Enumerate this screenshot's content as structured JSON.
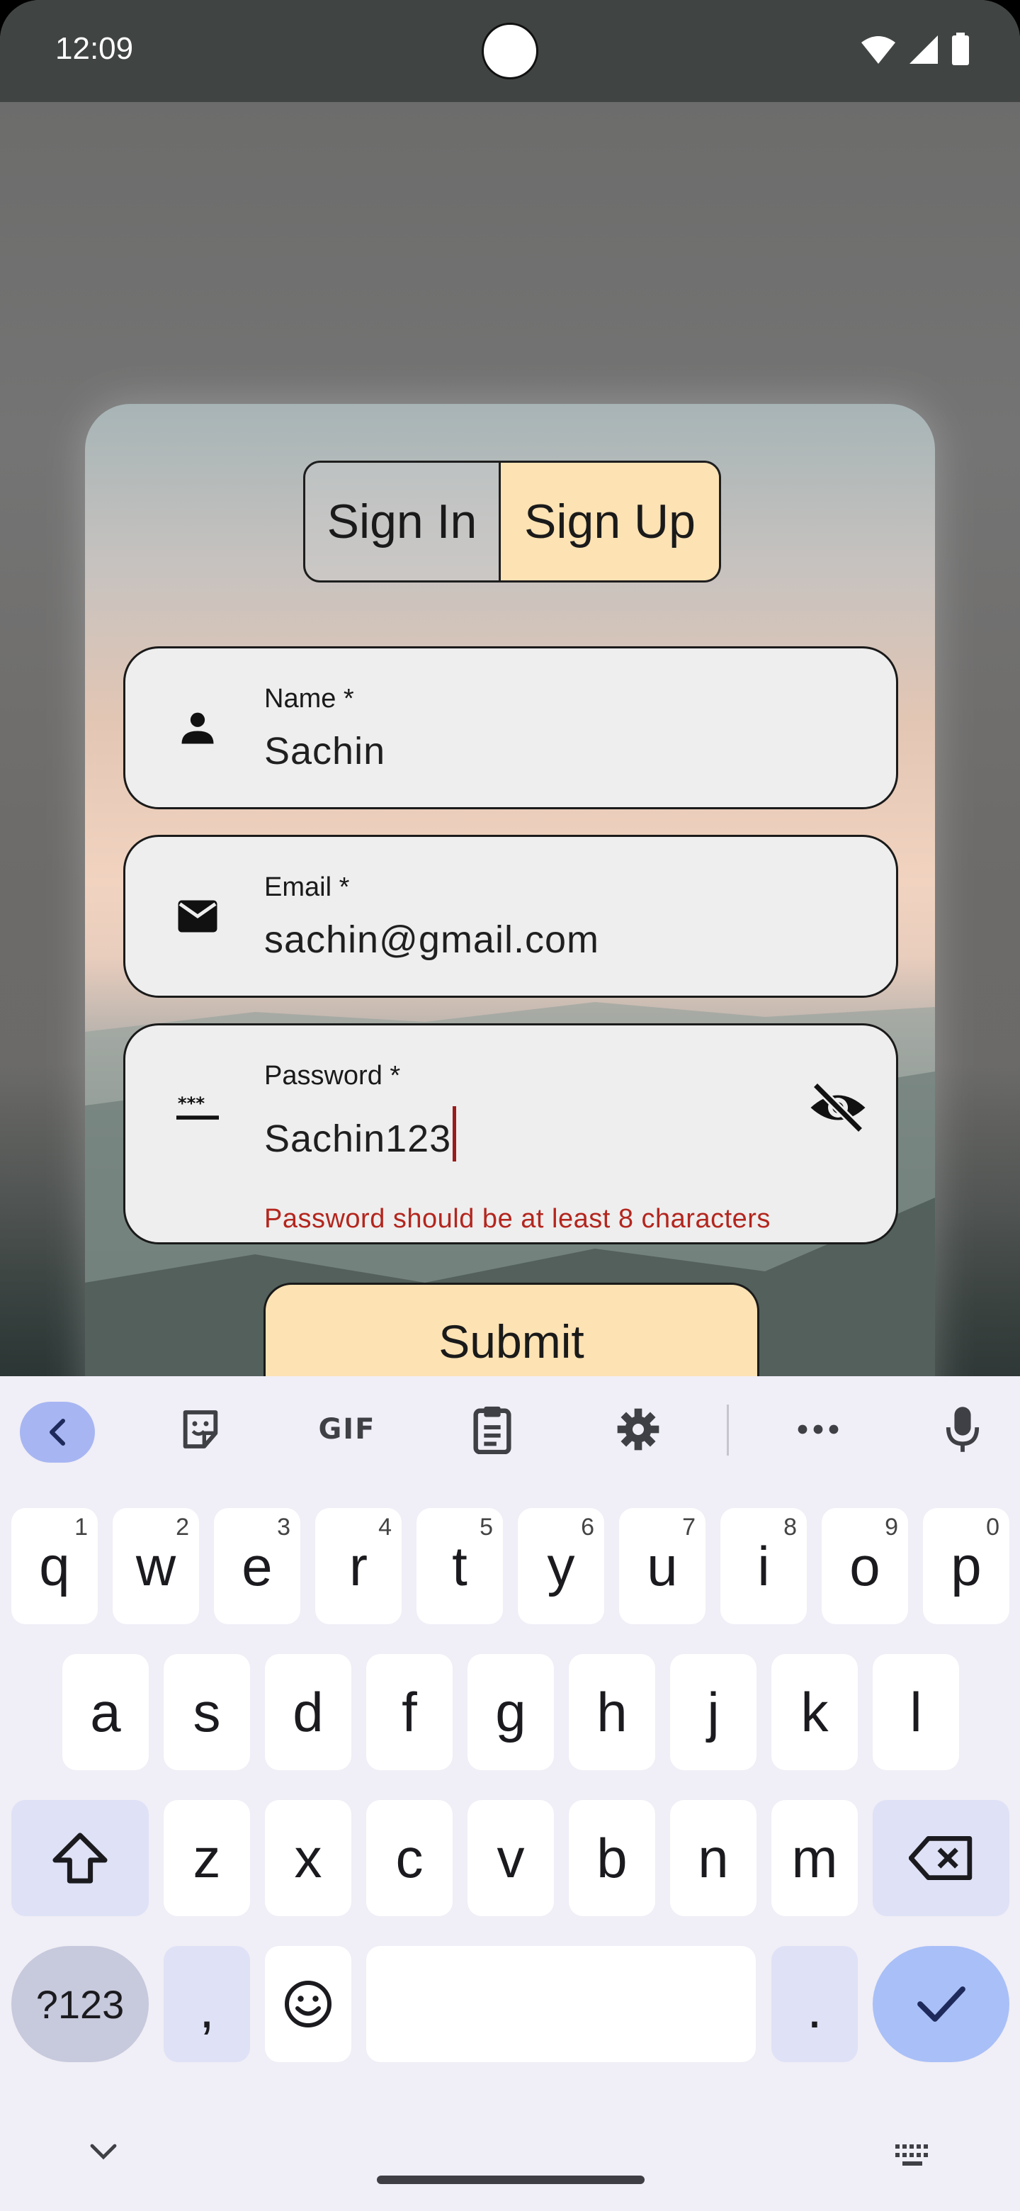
{
  "status_bar": {
    "time": "12:09"
  },
  "auth": {
    "tabs": {
      "sign_in": "Sign In",
      "sign_up": "Sign Up",
      "selected": "Sign Up"
    },
    "name": {
      "label": "Name *",
      "value": "Sachin",
      "icon": "person-icon"
    },
    "email": {
      "label": "Email *",
      "value": "sachin@gmail.com",
      "icon": "mail-icon"
    },
    "password": {
      "label": "Password *",
      "value": "Sachin123",
      "icon": "password-icon",
      "error": "Password should be at least 8 characters",
      "toggle_icon": "visibility-off-icon"
    },
    "submit_label": "Submit"
  },
  "keyboard": {
    "toolbar": [
      "back-icon",
      "sticker-icon",
      "GIF",
      "clipboard-icon",
      "settings-icon",
      "more-icon",
      "mic-icon"
    ],
    "gif_label": "GIF",
    "row1": [
      "q",
      "w",
      "e",
      "r",
      "t",
      "y",
      "u",
      "i",
      "o",
      "p"
    ],
    "row1_hints": [
      "1",
      "2",
      "3",
      "4",
      "5",
      "6",
      "7",
      "8",
      "9",
      "0"
    ],
    "row2": [
      "a",
      "s",
      "d",
      "f",
      "g",
      "h",
      "j",
      "k",
      "l"
    ],
    "row3": [
      "z",
      "x",
      "c",
      "v",
      "b",
      "n",
      "m"
    ],
    "sym_label": "?123",
    "comma": ",",
    "period": "."
  },
  "colors": {
    "accent": "#fde2b3",
    "error": "#b3261e",
    "keyboard_bg": "#f0eef6",
    "enter_key": "#a9bff7"
  }
}
